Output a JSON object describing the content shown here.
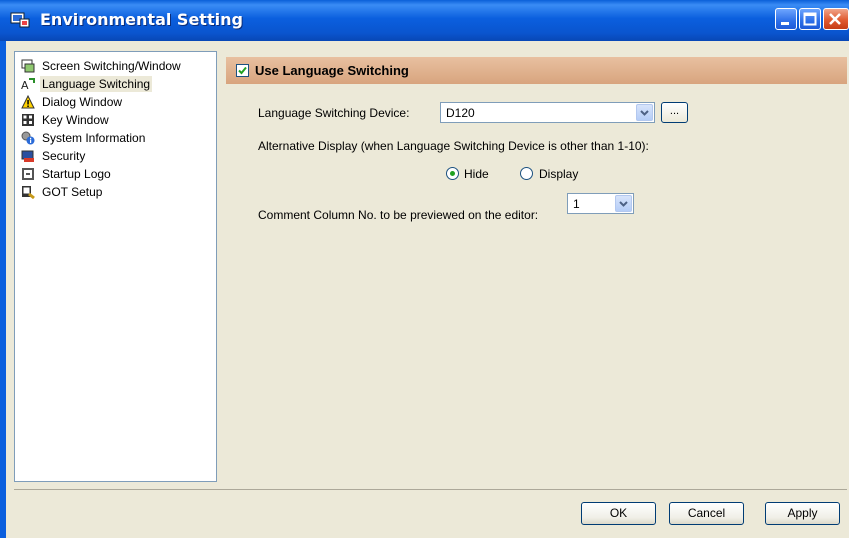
{
  "window": {
    "title": "Environmental Setting"
  },
  "tree": {
    "items": [
      {
        "label": "Screen Switching/Window",
        "icon": "screen-switching-icon"
      },
      {
        "label": "Language Switching",
        "icon": "language-icon",
        "selected": true
      },
      {
        "label": "Dialog Window",
        "icon": "warning-icon"
      },
      {
        "label": "Key Window",
        "icon": "keypad-icon"
      },
      {
        "label": "System Information",
        "icon": "system-info-icon"
      },
      {
        "label": "Security",
        "icon": "security-icon"
      },
      {
        "label": "Startup Logo",
        "icon": "startup-logo-icon"
      },
      {
        "label": "GOT Setup",
        "icon": "got-setup-icon"
      }
    ]
  },
  "section": {
    "title": "Use Language Switching",
    "checked": true
  },
  "device": {
    "label": "Language Switching Device:",
    "value": "D120",
    "browse_label": "..."
  },
  "alt_display": {
    "label": "Alternative Display (when Language Switching Device is other than 1-10):",
    "options": [
      {
        "label": "Hide",
        "selected": true
      },
      {
        "label": "Display",
        "selected": false
      }
    ]
  },
  "comment_column": {
    "label": "Comment Column No. to be previewed on the editor:",
    "value": "1"
  },
  "buttons": {
    "ok": "OK",
    "cancel": "Cancel",
    "apply": "Apply"
  },
  "colors": {
    "titlebar": "#0a5fd8",
    "section_bar": "#dcae8a",
    "radio_dot": "#21a121"
  }
}
